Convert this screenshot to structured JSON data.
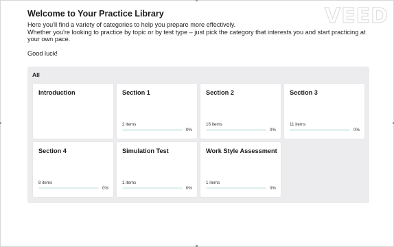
{
  "watermark": "VEED",
  "page": {
    "title": "Welcome to Your Practice Library",
    "intro_line1": "Here you'll find a variety of categories to help you prepare more effectively.",
    "intro_line2": "Whether you're looking to practice by topic or by test type – just pick the category that interests you and start practicing at your own pace.",
    "good_luck": "Good luck!"
  },
  "library": {
    "filter_label": "All",
    "cards": [
      {
        "title": "Introduction",
        "count": "",
        "percent": "",
        "progress": null
      },
      {
        "title": "Section 1",
        "count": "2 items",
        "percent": "0%",
        "progress": 0
      },
      {
        "title": "Section 2",
        "count": "16 items",
        "percent": "0%",
        "progress": 0
      },
      {
        "title": "Section 3",
        "count": "11 items",
        "percent": "0%",
        "progress": 0
      },
      {
        "title": "Section 4",
        "count": "8 items",
        "percent": "0%",
        "progress": 0
      },
      {
        "title": "Simulation Test",
        "count": "1 items",
        "percent": "0%",
        "progress": 0
      },
      {
        "title": "Work Style Assessment",
        "count": "1 items",
        "percent": "0%",
        "progress": 0
      }
    ]
  }
}
